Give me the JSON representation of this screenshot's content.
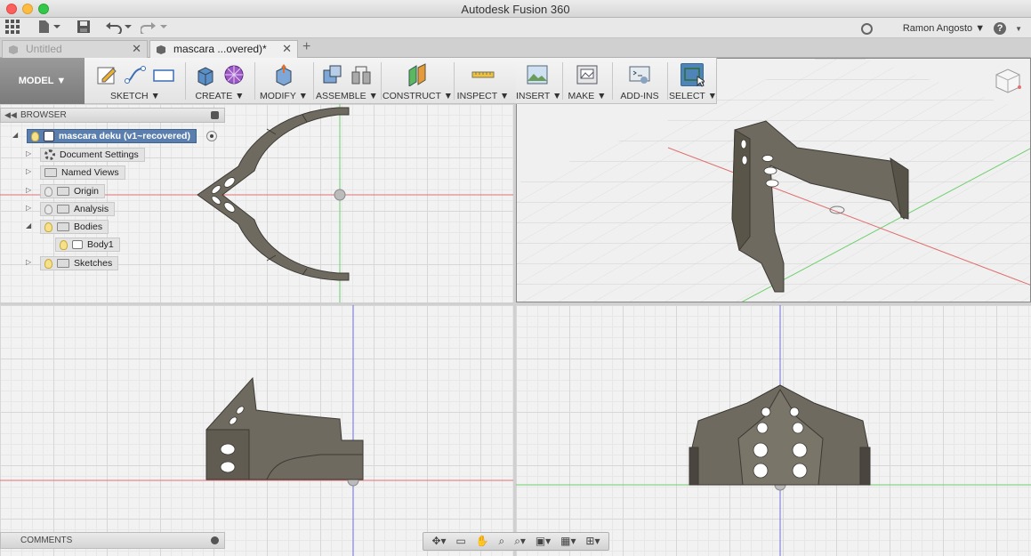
{
  "window": {
    "title": "Autodesk Fusion 360"
  },
  "user": {
    "name": "Ramon Angosto ▼",
    "help": "?"
  },
  "tabs": [
    {
      "label": "Untitled",
      "active": false
    },
    {
      "label": "mascara ...overed)*",
      "active": true
    }
  ],
  "toolbar": {
    "workspace": "MODEL ▼",
    "groups": {
      "sketch": "SKETCH ▼",
      "create": "CREATE ▼",
      "modify": "MODIFY ▼",
      "assemble": "ASSEMBLE ▼",
      "construct": "CONSTRUCT ▼",
      "inspect": "INSPECT ▼",
      "insert": "INSERT ▼",
      "make": "MAKE ▼",
      "addins": "ADD-INS",
      "select": "SELECT ▼"
    }
  },
  "browser": {
    "title": "BROWSER",
    "root": "mascara deku (v1~recovered)",
    "items": [
      {
        "label": "Document Settings"
      },
      {
        "label": "Named Views"
      },
      {
        "label": "Origin"
      },
      {
        "label": "Analysis"
      },
      {
        "label": "Bodies"
      },
      {
        "label": "Body1"
      },
      {
        "label": "Sketches"
      }
    ]
  },
  "comments": {
    "title": "COMMENTS"
  },
  "colors": {
    "model_body": "#6f6a60",
    "accent_blue": "#4f84b8",
    "axis_red": "#e07070",
    "axis_green": "#6fcf6f",
    "axis_blue": "#7070e0"
  }
}
